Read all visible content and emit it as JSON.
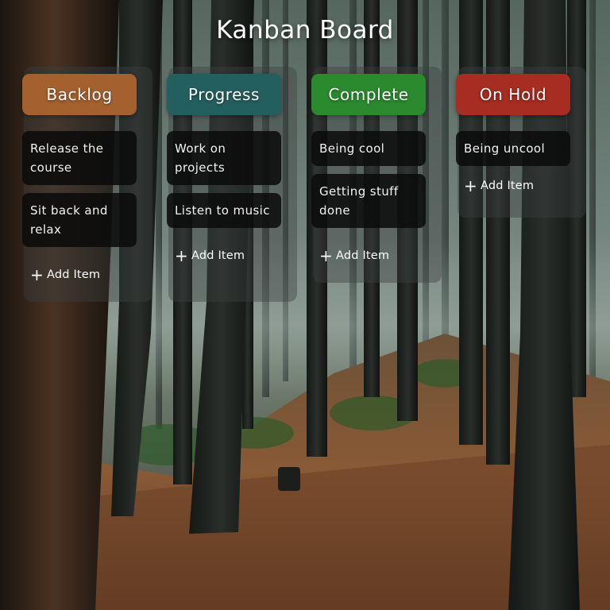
{
  "board": {
    "title": "Kanban Board"
  },
  "colors": {
    "backlog": "#a4602f",
    "progress": "#245f60",
    "complete": "#2b8a2e",
    "on_hold": "#a72c22"
  },
  "columns": [
    {
      "key": "backlog",
      "title": "Backlog",
      "items": [
        "Release the course",
        "Sit back and relax"
      ],
      "add_label": "Add Item"
    },
    {
      "key": "progress",
      "title": "Progress",
      "items": [
        "Work on projects",
        "Listen to music"
      ],
      "add_label": "Add Item"
    },
    {
      "key": "complete",
      "title": "Complete",
      "items": [
        "Being cool",
        "Getting stuff done"
      ],
      "add_label": "Add Item"
    },
    {
      "key": "on_hold",
      "title": "On Hold",
      "items": [
        "Being uncool"
      ],
      "add_label": "Add Item"
    }
  ],
  "icons": {
    "add": "plus-icon"
  }
}
